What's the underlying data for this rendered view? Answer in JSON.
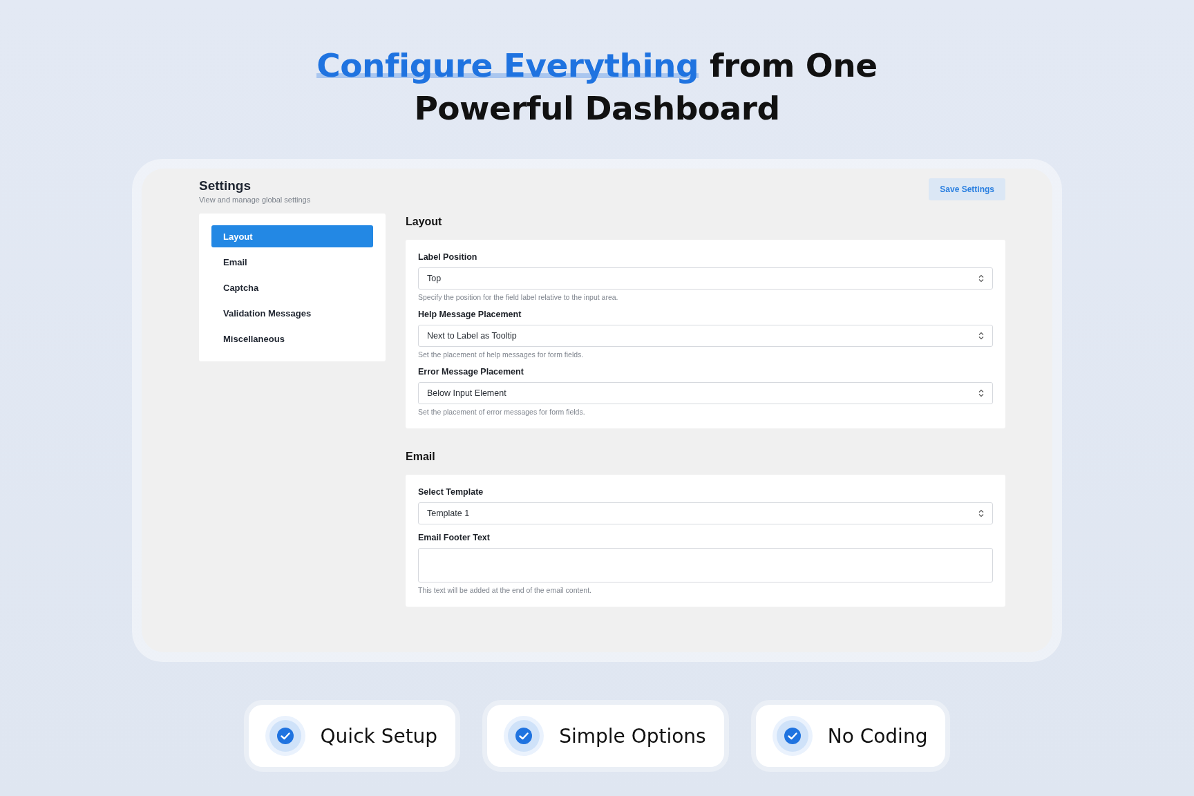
{
  "headline": {
    "highlight": "Configure Everything",
    "rest_line_1": "from One",
    "line_2": "Powerful Dashboard"
  },
  "header": {
    "title": "Settings",
    "subtitle": "View and manage global settings",
    "save_button": "Save Settings"
  },
  "sidebar": {
    "items": [
      {
        "label": "Layout",
        "selected": true
      },
      {
        "label": "Email",
        "selected": false
      },
      {
        "label": "Captcha",
        "selected": false
      },
      {
        "label": "Validation Messages",
        "selected": false
      },
      {
        "label": "Miscellaneous",
        "selected": false
      }
    ]
  },
  "sections": [
    {
      "title": "Layout",
      "fields": [
        {
          "kind": "select",
          "label": "Label Position",
          "value": "Top",
          "help": "Specify the position for the field label relative to the input area."
        },
        {
          "kind": "select",
          "label": "Help Message Placement",
          "value": "Next to Label as Tooltip",
          "help": "Set the placement of help messages for form fields."
        },
        {
          "kind": "select",
          "label": "Error Message Placement",
          "value": "Below Input Element",
          "help": "Set the placement of error messages for form fields."
        }
      ]
    },
    {
      "title": "Email",
      "fields": [
        {
          "kind": "select",
          "label": "Select Template",
          "value": "Template 1"
        },
        {
          "kind": "textarea",
          "label": "Email Footer Text",
          "help": "This text will be added at the end of the email content."
        }
      ]
    }
  ],
  "features": [
    "Quick Setup",
    "Simple Options",
    "No Coding"
  ]
}
